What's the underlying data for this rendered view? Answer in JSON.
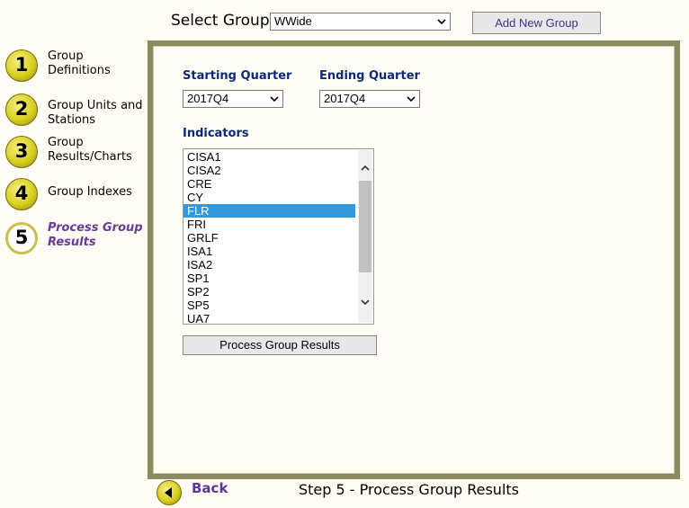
{
  "header": {
    "select_group_label": "Select Group",
    "group_value": "WWide",
    "add_group_label": "Add New Group"
  },
  "sidebar": {
    "steps": [
      {
        "number": "1",
        "label": "Group Definitions"
      },
      {
        "number": "2",
        "label": "Group Units and Stations"
      },
      {
        "number": "3",
        "label": "Group Results/Charts"
      },
      {
        "number": "4",
        "label": "Group Indexes"
      },
      {
        "number": "5",
        "label": "Process Group Results",
        "active": true
      }
    ]
  },
  "main": {
    "starting_quarter_label": "Starting Quarter",
    "starting_quarter_value": "2017Q4",
    "ending_quarter_label": "Ending Quarter",
    "ending_quarter_value": "2017Q4",
    "indicators_label": "Indicators",
    "indicators": [
      "CISA1",
      "CISA2",
      "CRE",
      "CY",
      "FLR",
      "FRI",
      "GRLF",
      "ISA1",
      "ISA2",
      "SP1",
      "SP2",
      "SP5",
      "UA7"
    ],
    "selected_indicator": "FLR",
    "process_button_label": "Process Group Results"
  },
  "footer": {
    "back_label": "Back",
    "step_title": "Step 5 - Process Group Results"
  },
  "colors": {
    "panel_border": "#8b8b5f",
    "heading_blue": "#0d2a7a",
    "accent_purple": "#6a3a99",
    "selection_blue": "#3399dd"
  }
}
